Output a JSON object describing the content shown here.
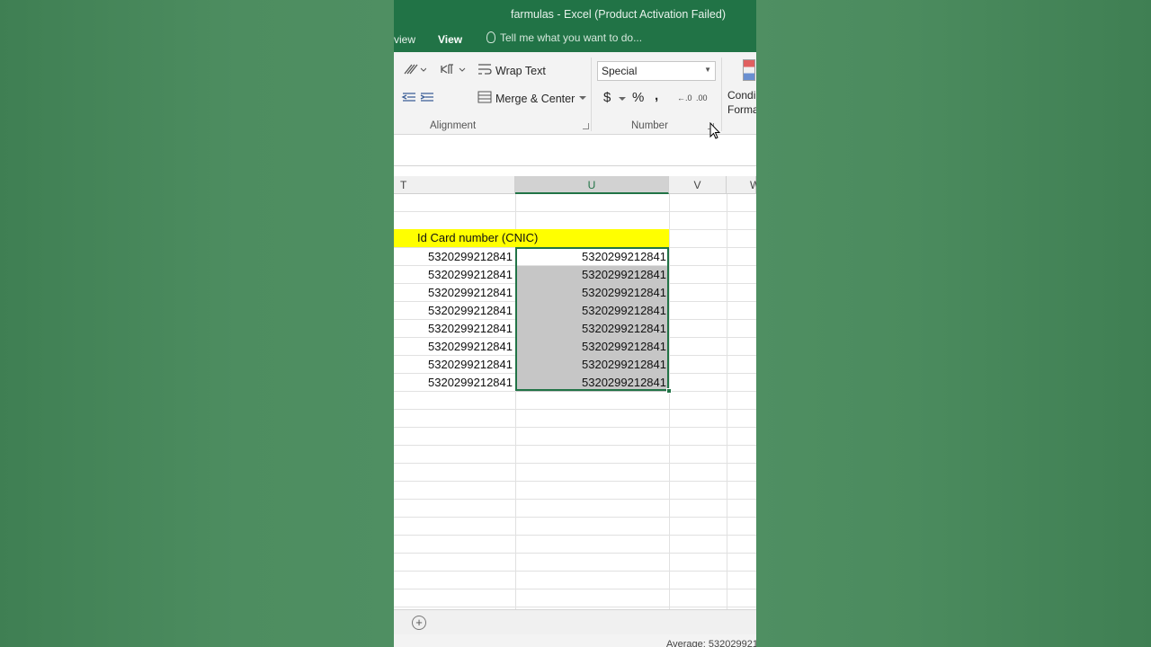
{
  "window": {
    "title": "farmulas - Excel (Product Activation Failed)"
  },
  "tabs": {
    "review_partial": "view",
    "view": "View"
  },
  "tell_me": {
    "placeholder": "Tell me what you want to do..."
  },
  "ribbon": {
    "alignment": {
      "wrap_text": "Wrap Text",
      "merge_center": "Merge & Center",
      "group_label": "Alignment"
    },
    "number": {
      "format_value": "Special",
      "currency": "$",
      "percent": "%",
      "comma": ",",
      "group_label": "Number"
    },
    "styles": {
      "conditional_formatting_partial": "Condi\nForma"
    }
  },
  "columns": [
    "T",
    "U",
    "V",
    "W"
  ],
  "selected_column": "U",
  "table": {
    "header": "Id Card number (CNIC)",
    "rows": [
      {
        "t": "5320299212841",
        "u": "5320299212841"
      },
      {
        "t": "5320299212841",
        "u": "5320299212841"
      },
      {
        "t": "5320299212841",
        "u": "5320299212841"
      },
      {
        "t": "5320299212841",
        "u": "5320299212841"
      },
      {
        "t": "5320299212841",
        "u": "5320299212841"
      },
      {
        "t": "5320299212841",
        "u": "5320299212841"
      },
      {
        "t": "5320299212841",
        "u": "5320299212841"
      },
      {
        "t": "5320299212841",
        "u": "5320299212841"
      }
    ]
  },
  "status": {
    "average": "Average: 532029921"
  },
  "colors": {
    "excel_green": "#217346",
    "header_fill": "#ffff00",
    "selection_fill": "#c6c6c6"
  }
}
